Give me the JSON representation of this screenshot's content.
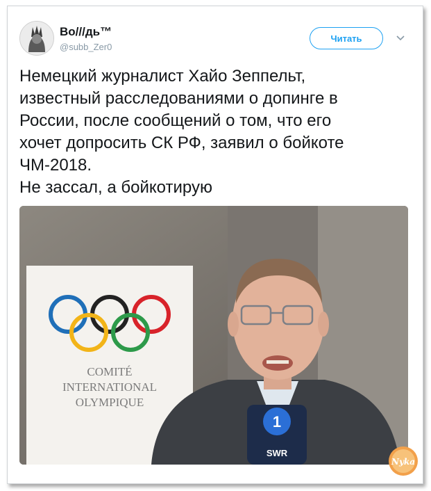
{
  "tweet": {
    "author_name": "Во///дь™",
    "author_handle": "@subb_Zer0",
    "follow_label": "Читать",
    "text": "Немецкий журналист Хайо Зеппельт,\nизвестный расследованиями о допинге в\nРоссии, после сообщений о том, что его\nхочет допросить СК РФ, заявил о бойкоте\nЧМ-2018.\nНе зассал, а бойкотирую"
  },
  "photo": {
    "banner_line1": "COMITÉ",
    "banner_line2": "INTERNATIONAL",
    "banner_line3": "OLYMPIQUE",
    "mic_text": "SWR",
    "mic_logo": "1"
  },
  "watermark": {
    "text": "Nyka"
  },
  "colors": {
    "accent": "#1da1f2",
    "ring_blue": "#1f6fb8",
    "ring_yellow": "#f2b418",
    "ring_black": "#222222",
    "ring_green": "#2d9a4a",
    "ring_red": "#d8232a"
  }
}
